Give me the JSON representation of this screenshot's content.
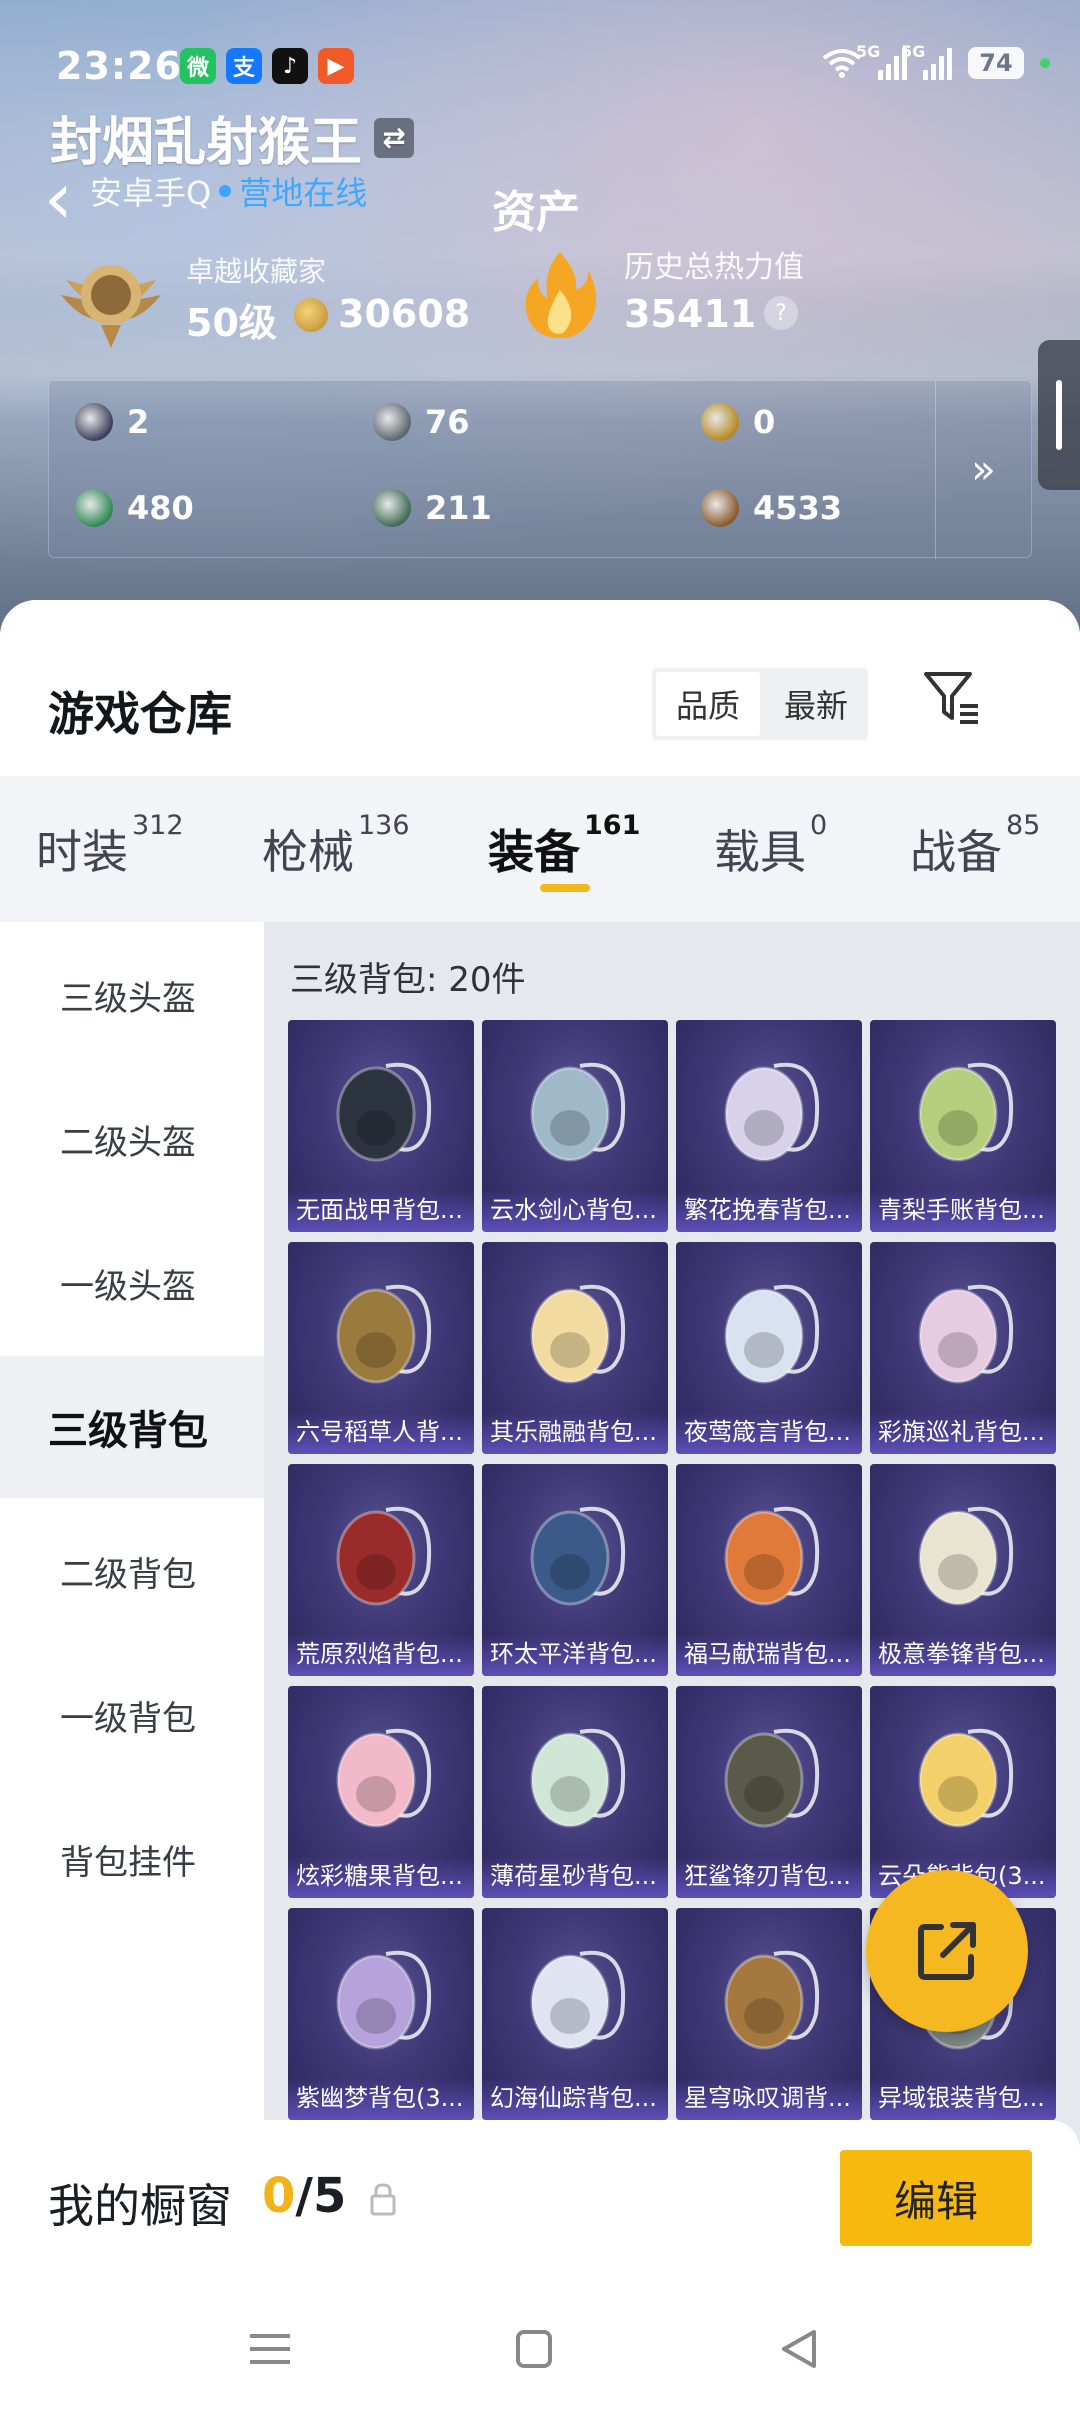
{
  "status_bar": {
    "time": "23:26",
    "apps": [
      {
        "glyph": "微",
        "color": "#21c25f"
      },
      {
        "glyph": "支",
        "color": "#1677ff"
      },
      {
        "glyph": "♪",
        "color": "#111111"
      },
      {
        "glyph": "▶",
        "color": "#f05a28"
      }
    ],
    "network": "5G",
    "battery": "74"
  },
  "header": {
    "username": "封烟乱射猴王",
    "platform": "安卓手Q",
    "online_status": "营地在线",
    "page_title": "资产",
    "collector_label": "卓越收藏家",
    "level": "50级",
    "coins": "30608",
    "heat_label": "历史总热力值",
    "heat_value": "35411",
    "help": "?"
  },
  "assets": {
    "items": [
      {
        "value": "2",
        "color": "#3c3f5a"
      },
      {
        "value": "76",
        "color": "#5d6670"
      },
      {
        "value": "0",
        "color": "#b58a1f"
      },
      {
        "value": "480",
        "color": "#2f8a55"
      },
      {
        "value": "211",
        "color": "#3f6b55"
      },
      {
        "value": "4533",
        "color": "#8a5a2d"
      }
    ],
    "more": "»"
  },
  "warehouse": {
    "title": "游戏仓库",
    "sort_options": [
      "品质",
      "最新"
    ],
    "tabs": [
      {
        "label": "时装",
        "count": "312"
      },
      {
        "label": "枪械",
        "count": "136"
      },
      {
        "label": "装备",
        "count": "161"
      },
      {
        "label": "载具",
        "count": "0"
      },
      {
        "label": "战备",
        "count": "85"
      }
    ],
    "categories": [
      "三级头盔",
      "二级头盔",
      "一级头盔",
      "三级背包",
      "二级背包",
      "一级背包",
      "背包挂件"
    ],
    "group_title": "三级背包: 20件",
    "items": [
      {
        "name": "无面战甲背包...",
        "color": "#2c3440"
      },
      {
        "name": "云水剑心背包...",
        "color": "#9fb9c9"
      },
      {
        "name": "繁花挽春背包...",
        "color": "#d7d2ea"
      },
      {
        "name": "青梨手账背包...",
        "color": "#b6cf7e"
      },
      {
        "name": "六号稻草人背...",
        "color": "#9b7a3d"
      },
      {
        "name": "其乐融融背包...",
        "color": "#f2dba0"
      },
      {
        "name": "夜莺箴言背包...",
        "color": "#d9e2f0"
      },
      {
        "name": "彩旗巡礼背包...",
        "color": "#e6cbe1"
      },
      {
        "name": "荒原烈焰背包...",
        "color": "#9a2b2b"
      },
      {
        "name": "环太平洋背包...",
        "color": "#3b5a8a"
      },
      {
        "name": "福马献瑞背包...",
        "color": "#e07a3a"
      },
      {
        "name": "极意拳锋背包...",
        "color": "#e9e4cf"
      },
      {
        "name": "炫彩糖果背包...",
        "color": "#f2b9c8"
      },
      {
        "name": "薄荷星砂背包...",
        "color": "#cfe6d6"
      },
      {
        "name": "狂鲨锋刃背包...",
        "color": "#5a5a4a"
      },
      {
        "name": "云朵熊背包(3...",
        "color": "#f3d06a"
      },
      {
        "name": "紫幽梦背包(3...",
        "color": "#b6a3dc"
      },
      {
        "name": "幻海仙踪背包...",
        "color": "#dfe3f2"
      },
      {
        "name": "星穹咏叹调背...",
        "color": "#a5783f"
      },
      {
        "name": "异域银装背包...",
        "color": "#7e8a88"
      }
    ]
  },
  "showcase": {
    "label": "我的橱窗",
    "current": "0",
    "total": "/5",
    "edit_label": "编辑"
  }
}
